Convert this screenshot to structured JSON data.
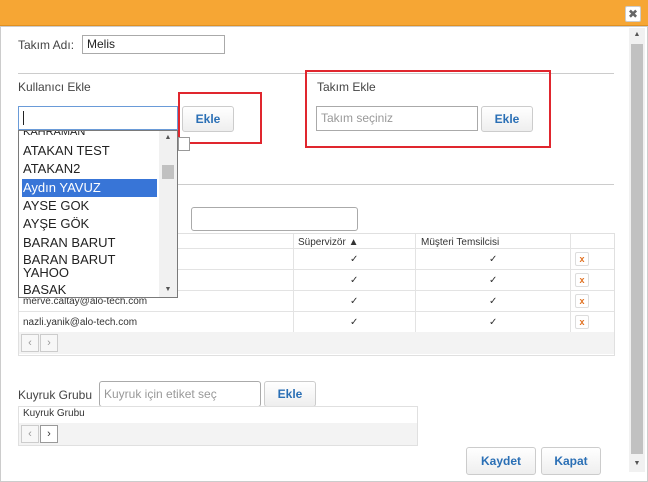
{
  "window": {
    "close_glyph": "✖"
  },
  "team_name": {
    "label": "Takım Adı:",
    "value": "Melis"
  },
  "user_add": {
    "title": "Kullanıcı Ekle",
    "input_value": "",
    "button": "Ekle"
  },
  "team_add": {
    "title": "Takım Ekle",
    "placeholder": "Takım seçiniz",
    "button": "Ekle"
  },
  "dropdown": {
    "partial_item": "KAHRAMAN",
    "items": [
      "ATAKAN TEST",
      "ATAKAN2",
      "Aydın YAVUZ",
      "AYSE GOK",
      "AYŞE GÖK",
      "BARAN BARUT",
      "BARAN BARUT YAHOO",
      "BASAK"
    ],
    "selected": "Aydın YAVUZ"
  },
  "users_grid": {
    "columns": [
      "Süpervizör ▲",
      "Müşteri Temsilcisi"
    ],
    "check": "✓",
    "delete_glyph": "x",
    "rows": [
      {
        "email": ""
      },
      {
        "email": ""
      },
      {
        "email": "merve.caltay@alo-tech.com"
      },
      {
        "email": "nazli.yanik@alo-tech.com"
      }
    ]
  },
  "queue_group": {
    "label": "Kuyruk Grubu",
    "placeholder": "Kuyruk için etiket seç",
    "button": "Ekle",
    "column": "Kuyruk Grubu"
  },
  "pager": {
    "prev": "‹",
    "next": "›"
  },
  "footer": {
    "save": "Kaydet",
    "close": "Kapat"
  },
  "colors": {
    "header": "#f6a634",
    "highlight": "#e0262e",
    "selection": "#3875d7",
    "button_text": "#2a6fb5"
  }
}
